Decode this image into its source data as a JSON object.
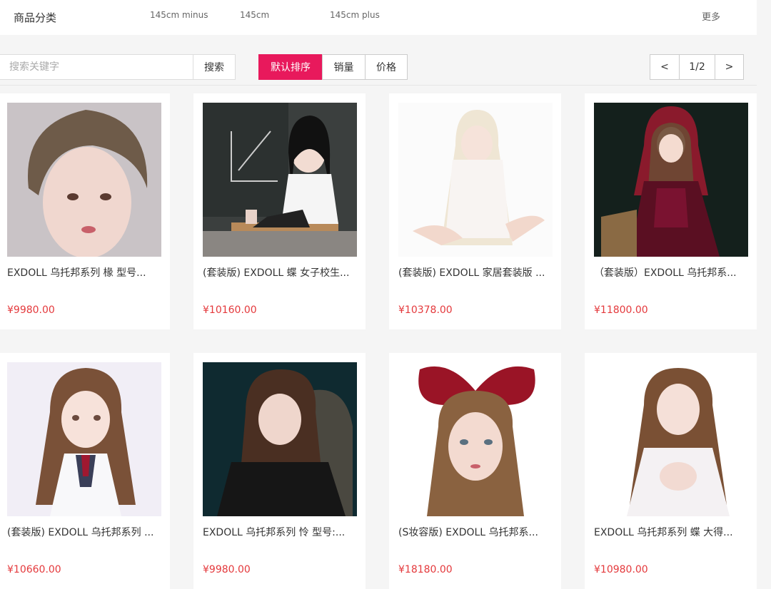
{
  "category_bar": {
    "title": "商品分类",
    "items": [
      "145cm minus",
      "145cm",
      "145cm plus"
    ],
    "more": "更多"
  },
  "toolbar": {
    "search_placeholder": "搜索关键字",
    "search_label": "搜索",
    "sort": [
      "默认排序",
      "销量",
      "价格"
    ],
    "sort_active": "默认排序",
    "accent_color": "#e8195c"
  },
  "pager": {
    "prev": "<",
    "page": "1/2",
    "next": ">"
  },
  "products": [
    {
      "name": "EXDOLL 乌托邦系列 椽 型号...",
      "price": "¥9980.00"
    },
    {
      "name": "(套装版) EXDOLL 蝶 女子校生...",
      "price": "¥10160.00"
    },
    {
      "name": "(套装版) EXDOLL 家居套装版 ...",
      "price": "¥10378.00"
    },
    {
      "name": "（套装版）EXDOLL 乌托邦系...",
      "price": "¥11800.00"
    },
    {
      "name": "(套装版) EXDOLL 乌托邦系列 ...",
      "price": "¥10660.00"
    },
    {
      "name": "EXDOLL 乌托邦系列 怜 型号:...",
      "price": "¥9980.00"
    },
    {
      "name": "(S妆容版) EXDOLL 乌托邦系...",
      "price": "¥18180.00"
    },
    {
      "name": "EXDOLL 乌托邦系列 蝶 大得...",
      "price": "¥10980.00"
    }
  ],
  "price_color": "#e4393c"
}
